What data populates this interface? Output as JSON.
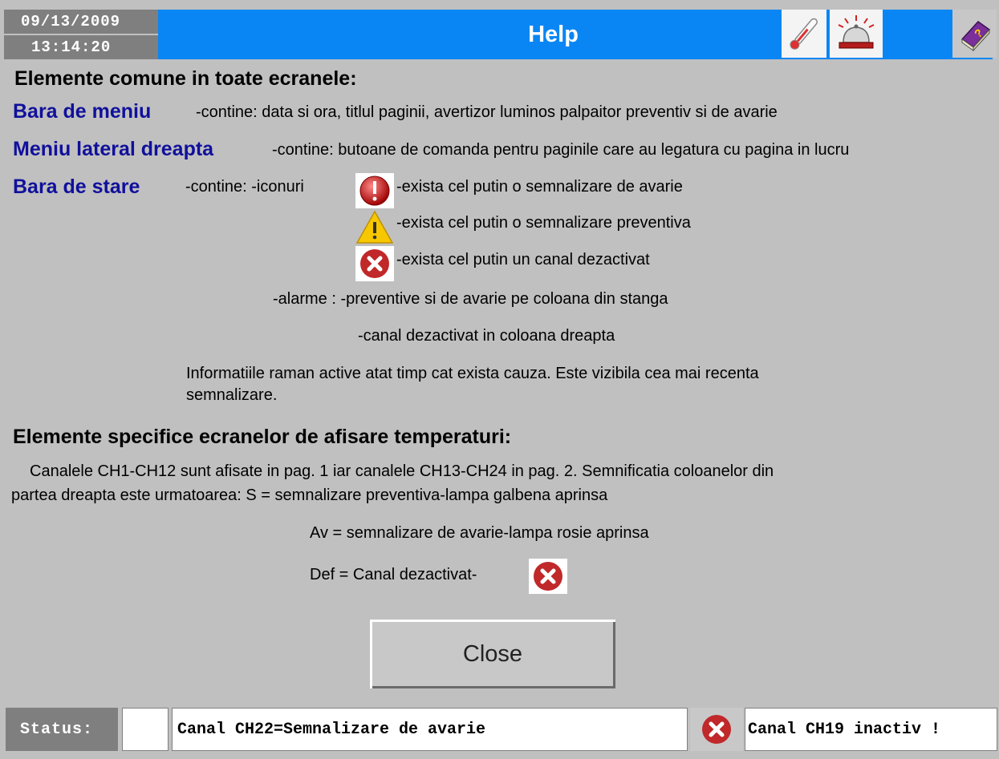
{
  "header": {
    "date": "09/13/2009",
    "time": "13:14:20",
    "title": "Help",
    "icons": [
      "thermometer-icon",
      "alarm-bell-icon",
      "help-book-icon"
    ]
  },
  "colors": {
    "title_bar": "#0a86f4",
    "term_text": "#10109c",
    "background": "#c0c0c0",
    "datetime_bg": "#7f7f7f"
  },
  "section1": {
    "heading": "Elemente comune in toate ecranele:",
    "menu_bar": {
      "term": "Bara de meniu",
      "desc": "-contine: data si ora, titlul paginii, avertizor luminos palpaitor preventiv si de avarie"
    },
    "side_menu": {
      "term": "Meniu lateral dreapta",
      "desc": "-contine: butoane de comanda pentru paginile care au legatura cu pagina in lucru"
    },
    "status_bar": {
      "term": "Bara de stare",
      "contine": "-contine: -iconuri",
      "icon_alarm_desc": "-exista cel putin o semnalizare de avarie",
      "icon_warning_desc": "-exista cel putin o semnalizare preventiva",
      "icon_disabled_desc": "-exista cel putin un canal dezactivat",
      "alarme_label": "-alarme : -preventive si de avarie pe coloana din stanga",
      "alarme_right": "-canal dezactivat in coloana dreapta",
      "info_line1": "Informatiile raman active atat timp cat exista cauza. Este vizibila cea mai recenta",
      "info_line2": "semnalizare."
    }
  },
  "section2": {
    "heading": "Elemente specifice ecranelor de afisare temperaturi:",
    "para_line1": "Canalele CH1-CH12 sunt afisate in pag. 1 iar canalele CH13-CH24 in pag. 2. Semnificatia coloanelor din",
    "para_line2": "partea dreapta este urmatoarea: S = semnalizare preventiva-lampa galbena aprinsa",
    "av_line": "Av = semnalizare de avarie-lampa rosie aprinsa",
    "def_line": "Def = Canal dezactivat-"
  },
  "close_label": "Close",
  "statusbar": {
    "label": "Status:",
    "alarm_text": "Canal CH22=Semnalizare de avarie",
    "icon": "channel-disabled-icon",
    "channel_text": "Canal CH19 inactiv !"
  }
}
